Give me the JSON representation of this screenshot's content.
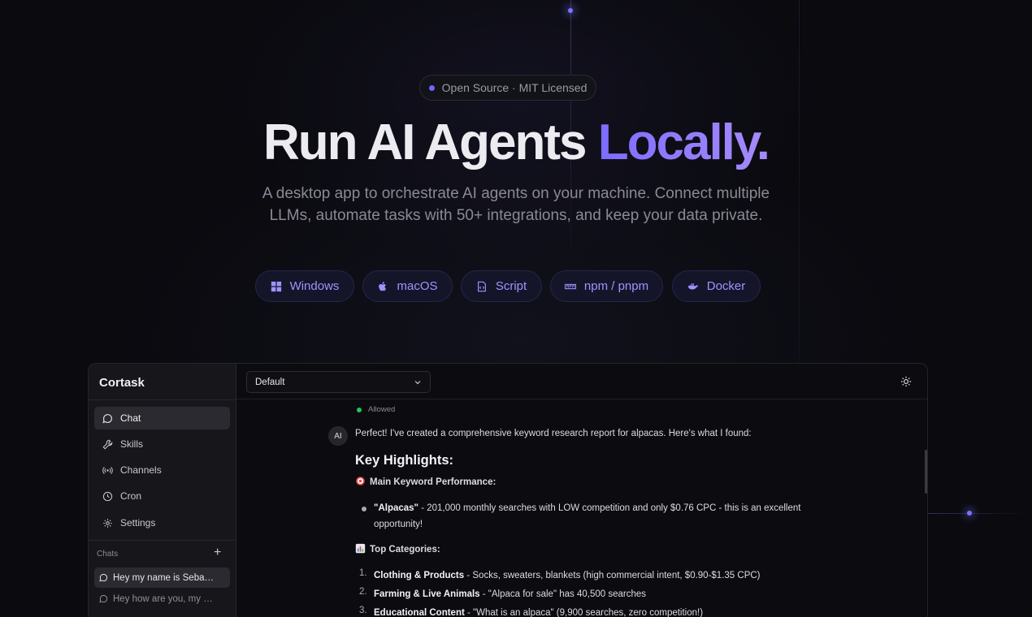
{
  "hero": {
    "badge": "Open Source · MIT Licensed",
    "title_main": "Run AI Agents",
    "title_accent": "Locally.",
    "subtitle": "A desktop app to orchestrate AI agents on your machine. Connect multiple LLMs, automate tasks with 50+ integrations, and keep your data private."
  },
  "downloads": [
    {
      "label": "Windows",
      "icon": "windows-icon"
    },
    {
      "label": "macOS",
      "icon": "apple-icon"
    },
    {
      "label": "Script",
      "icon": "script-icon"
    },
    {
      "label": "npm / pnpm",
      "icon": "npm-icon"
    },
    {
      "label": "Docker",
      "icon": "docker-icon"
    }
  ],
  "app": {
    "brand": "Cortask",
    "nav": [
      {
        "label": "Chat",
        "icon": "chat-bubble-icon",
        "active": true
      },
      {
        "label": "Skills",
        "icon": "wrench-icon"
      },
      {
        "label": "Channels",
        "icon": "broadcast-icon"
      },
      {
        "label": "Cron",
        "icon": "clock-icon"
      },
      {
        "label": "Settings",
        "icon": "gear-icon"
      }
    ],
    "chats_label": "Chats",
    "chats_add": "+",
    "chats": [
      {
        "label": "Hey my name is Seba…",
        "active": true
      },
      {
        "label": "Hey how are you, my …"
      }
    ],
    "workspace_select": "Default",
    "status": "Allowed",
    "avatar": "AI",
    "message": {
      "intro": "Perfect! I've created a comprehensive keyword research report for alpacas. Here's what I found:",
      "heading": "Key Highlights:",
      "section1": "Main Keyword Performance:",
      "bullet1_bold": "\"Alpacas\"",
      "bullet1_line1": " - 201,000 monthly searches with LOW competition and only $0.76 CPC - this is an excellent",
      "bullet1_line2": "opportunity!",
      "section2": "Top Categories:",
      "items": [
        {
          "num": "1.",
          "bold": "Clothing & Products",
          "text": " - Socks, sweaters, blankets (high commercial intent, $0.90-$1.35 CPC)"
        },
        {
          "num": "2.",
          "bold": "Farming & Live Animals",
          "text": " - \"Alpaca for sale\" has 40,500 searches"
        },
        {
          "num": "3.",
          "bold": "Educational Content",
          "text": " - \"What is an alpaca\" (9,900 searches, zero competition!)"
        }
      ]
    }
  },
  "colors": {
    "accent": "#7c6cff",
    "background": "#0a0a0f",
    "status_green": "#22c55e"
  }
}
